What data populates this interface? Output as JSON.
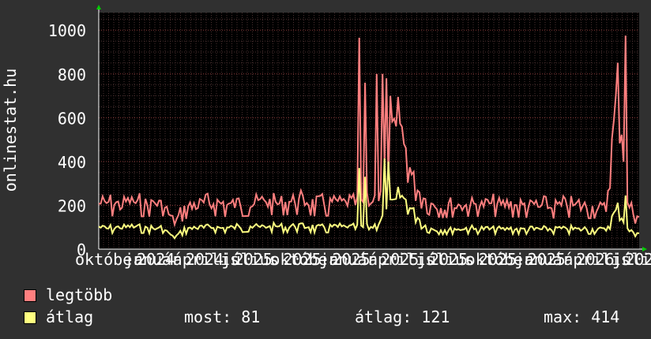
{
  "chart_data": {
    "type": "line",
    "ylabel": "onlinestat.hu",
    "ylim": [
      0,
      1080
    ],
    "yticks": [
      0,
      200,
      400,
      600,
      800,
      1000
    ],
    "grid": true,
    "xticks": [
      "október",
      "január",
      "április",
      "július",
      "október",
      "január",
      "április",
      "július",
      "október",
      "január",
      "április",
      "július",
      "október"
    ],
    "xtick_years": [
      "2024",
      "2024",
      "2025",
      "2025",
      "2025",
      "2025",
      "2025",
      "2025",
      "2025",
      "2026",
      "2026",
      "2026",
      "2026"
    ],
    "series": [
      {
        "name": "legtöbb",
        "color": "#ff7f7f",
        "envelope": [
          [
            0,
            262
          ],
          [
            6,
            260
          ],
          [
            11,
            255
          ],
          [
            17,
            265
          ],
          [
            22,
            258
          ],
          [
            28,
            255
          ],
          [
            33,
            258
          ],
          [
            39,
            150
          ],
          [
            44,
            235
          ],
          [
            50,
            255
          ],
          [
            56,
            258
          ],
          [
            61,
            258
          ],
          [
            67,
            252
          ],
          [
            72,
            258
          ],
          [
            78,
            262
          ],
          [
            83,
            272
          ],
          [
            89,
            268
          ],
          [
            94,
            265
          ],
          [
            100,
            270
          ],
          [
            106,
            272
          ],
          [
            111,
            260
          ],
          [
            117,
            262
          ],
          [
            122,
            265
          ],
          [
            128,
            268
          ],
          [
            133,
            258
          ],
          [
            139,
            258
          ],
          [
            144,
            300
          ],
          [
            150,
            600
          ],
          [
            155,
            730
          ],
          [
            161,
            420
          ],
          [
            167,
            300
          ],
          [
            172,
            250
          ],
          [
            178,
            245
          ],
          [
            183,
            250
          ],
          [
            189,
            255
          ],
          [
            194,
            255
          ],
          [
            200,
            250
          ],
          [
            206,
            255
          ],
          [
            211,
            250
          ],
          [
            217,
            248
          ],
          [
            222,
            245
          ],
          [
            228,
            245
          ],
          [
            233,
            240
          ],
          [
            239,
            245
          ],
          [
            244,
            248
          ],
          [
            250,
            245
          ],
          [
            256,
            240
          ],
          [
            261,
            230
          ],
          [
            267,
            980
          ],
          [
            272,
            245
          ],
          [
            278,
            180
          ]
        ]
      },
      {
        "name": "átlag",
        "color": "#ffff80",
        "envelope": [
          [
            0,
            118
          ],
          [
            6,
            115
          ],
          [
            11,
            115
          ],
          [
            17,
            120
          ],
          [
            22,
            115
          ],
          [
            28,
            112
          ],
          [
            33,
            115
          ],
          [
            39,
            60
          ],
          [
            44,
            108
          ],
          [
            50,
            118
          ],
          [
            56,
            118
          ],
          [
            61,
            118
          ],
          [
            67,
            118
          ],
          [
            72,
            120
          ],
          [
            78,
            125
          ],
          [
            83,
            120
          ],
          [
            89,
            122
          ],
          [
            94,
            120
          ],
          [
            100,
            122
          ],
          [
            106,
            125
          ],
          [
            111,
            118
          ],
          [
            117,
            118
          ],
          [
            122,
            120
          ],
          [
            128,
            120
          ],
          [
            133,
            115
          ],
          [
            139,
            115
          ],
          [
            144,
            140
          ],
          [
            150,
            230
          ],
          [
            155,
            300
          ],
          [
            161,
            220
          ],
          [
            167,
            130
          ],
          [
            172,
            105
          ],
          [
            178,
            105
          ],
          [
            183,
            108
          ],
          [
            189,
            110
          ],
          [
            194,
            108
          ],
          [
            200,
            108
          ],
          [
            206,
            110
          ],
          [
            211,
            108
          ],
          [
            217,
            108
          ],
          [
            222,
            108
          ],
          [
            228,
            108
          ],
          [
            233,
            108
          ],
          [
            239,
            110
          ],
          [
            244,
            108
          ],
          [
            250,
            108
          ],
          [
            256,
            108
          ],
          [
            261,
            100
          ],
          [
            267,
            230
          ],
          [
            272,
            105
          ],
          [
            278,
            85
          ]
        ]
      }
    ],
    "spikes": [
      {
        "series": 0,
        "day": 134,
        "value": 965
      },
      {
        "series": 0,
        "day": 137,
        "value": 760
      },
      {
        "series": 0,
        "day": 143,
        "value": 800
      },
      {
        "series": 0,
        "day": 146,
        "value": 800
      },
      {
        "series": 0,
        "day": 148,
        "value": 780
      },
      {
        "series": 0,
        "day": 150,
        "value": 700
      },
      {
        "series": 0,
        "day": 157,
        "value": 480
      },
      {
        "series": 0,
        "day": 271,
        "value": 975
      },
      {
        "series": 1,
        "day": 134,
        "value": 370
      },
      {
        "series": 1,
        "day": 137,
        "value": 330
      },
      {
        "series": 1,
        "day": 147,
        "value": 414
      },
      {
        "series": 1,
        "day": 149,
        "value": 400
      },
      {
        "series": 1,
        "day": 271,
        "value": 245
      }
    ]
  },
  "legend": {
    "max_label": "legtöbb",
    "avg_label": "átlag",
    "now": "most: 81",
    "average": "átlag: 121",
    "maximum": "max: 414"
  }
}
